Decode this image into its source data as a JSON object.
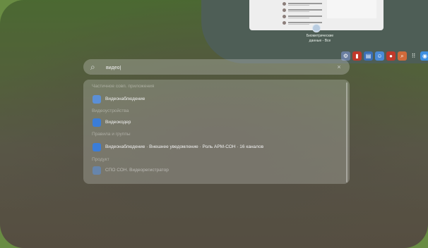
{
  "top_window": {
    "caption": "Биометрические\nданные - Все"
  },
  "dock": {
    "icons": [
      "gear-icon",
      "book-icon",
      "id-card-icon",
      "people-icon",
      "camera-icon",
      "search-icon",
      "grid-icon",
      "globe-icon"
    ]
  },
  "search": {
    "value": "видео|",
    "placeholder": "",
    "clear_glyph": "×"
  },
  "results": {
    "sections": [
      {
        "title": "Частичное совп. приложения"
      },
      {
        "title": "Видеоустройства"
      },
      {
        "title": "Правила и группы"
      },
      {
        "title": "Продукт"
      }
    ],
    "items": [
      {
        "label": "Видеонаблюдение"
      },
      {
        "label": "Видеокодер"
      },
      {
        "label": "Видеонаблюдение · Внешнее уведомление · Роль АРМ-СОН · 16 каналов"
      },
      {
        "label": "СПО СОН. Видеорегистратор"
      }
    ]
  },
  "colors": {
    "accent": "#3b7dd8",
    "app_icon_bg": "#5b8fd6"
  }
}
